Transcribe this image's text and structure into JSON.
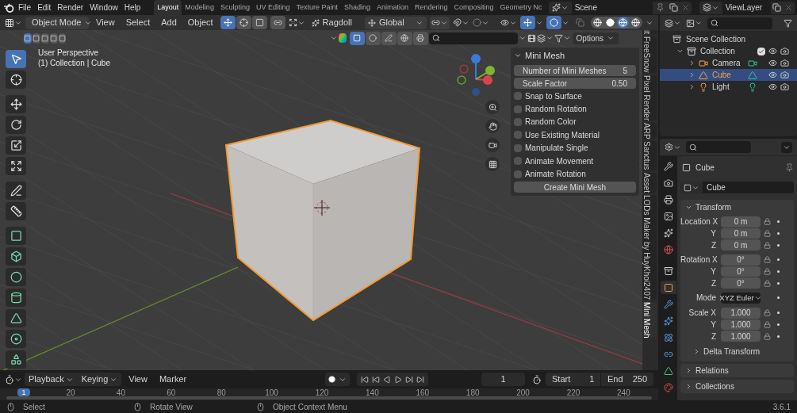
{
  "menu": [
    "File",
    "Edit",
    "Render",
    "Window",
    "Help"
  ],
  "workspaces": [
    {
      "label": "Layout",
      "selected": true
    },
    {
      "label": "Modeling",
      "selected": false
    },
    {
      "label": "Sculpting",
      "selected": false
    },
    {
      "label": "UV Editing",
      "selected": false
    },
    {
      "label": "Texture Paint",
      "selected": false
    },
    {
      "label": "Shading",
      "selected": false
    },
    {
      "label": "Animation",
      "selected": false
    },
    {
      "label": "Rendering",
      "selected": false
    },
    {
      "label": "Compositing",
      "selected": false
    },
    {
      "label": "Geometry Nc",
      "selected": false
    }
  ],
  "scene": "Scene",
  "view_layer": "ViewLayer",
  "viewport_header": {
    "mode": "Object Mode",
    "menus": [
      "View",
      "Select",
      "Add",
      "Object"
    ],
    "ragdoll": "Ragdoll",
    "orientation": "Global",
    "options": "Options"
  },
  "select_modes": [
    {
      "selected": true
    },
    {
      "selected": false
    },
    {
      "selected": false
    },
    {
      "selected": false
    },
    {
      "selected": false
    }
  ],
  "shading": [
    {
      "kind": "wireframe",
      "selected": false
    },
    {
      "kind": "solid",
      "selected": false
    },
    {
      "kind": "material",
      "selected": true
    },
    {
      "kind": "rendered",
      "selected": false
    }
  ],
  "viewport": {
    "perspective": "User Perspective",
    "context": "(1) Collection | Cube"
  },
  "tools": [
    {
      "kind": "select",
      "selected": true
    },
    {
      "kind": "cursor",
      "selected": false
    },
    {
      "kind": "move",
      "selected": false
    },
    {
      "kind": "rotate",
      "selected": false
    },
    {
      "kind": "scale",
      "selected": false
    },
    {
      "kind": "transform",
      "selected": false
    },
    {
      "kind": "annotate",
      "selected": false
    },
    {
      "kind": "measure",
      "selected": false
    },
    {
      "kind": "add-plane",
      "selected": false
    },
    {
      "kind": "add-cube",
      "selected": false
    },
    {
      "kind": "add-sphere",
      "selected": false
    },
    {
      "kind": "add-cylinder",
      "selected": false
    },
    {
      "kind": "add-cone",
      "selected": false
    },
    {
      "kind": "add-torus",
      "selected": false
    },
    {
      "kind": "add-wedge",
      "selected": false
    }
  ],
  "mini_mesh": {
    "title": "Mini Mesh",
    "fields": [
      {
        "label": "Number of Mini Meshes",
        "value": "5"
      },
      {
        "label": "Scale Factor",
        "value": "0.50"
      }
    ],
    "checkboxes": [
      {
        "label": "Snap to Surface",
        "checked": false
      },
      {
        "label": "Random Rotation",
        "checked": false
      },
      {
        "label": "Random Color",
        "checked": false
      },
      {
        "label": "Use Existing Material",
        "checked": false
      },
      {
        "label": "Manipulate Single",
        "checked": false
      },
      {
        "label": "Animate Movement",
        "checked": false
      },
      {
        "label": "Animate Rotation",
        "checked": false
      }
    ],
    "button": "Create Mini Mesh"
  },
  "side_tabs": [
    {
      "label": "it",
      "selected": false
    },
    {
      "label": "FreeSnow",
      "selected": false
    },
    {
      "label": "Pixel Render",
      "selected": false
    },
    {
      "label": "ARP",
      "selected": false
    },
    {
      "label": "Sanctus",
      "selected": false
    },
    {
      "label": "Asset",
      "selected": false
    },
    {
      "label": "LODs Maker by HuyKhoi2407",
      "selected": false
    },
    {
      "label": "Mini Mesh",
      "selected": true
    }
  ],
  "timeline": {
    "menus": [
      "Playback",
      "Keying",
      "View",
      "Marker"
    ],
    "current_frame": "1",
    "start_label": "Start",
    "start": "1",
    "end_label": "End",
    "end": "250",
    "playhead": "1",
    "ticks": [
      "20",
      "40",
      "60",
      "80",
      "100",
      "120",
      "140",
      "160",
      "180",
      "200",
      "220",
      "240"
    ]
  },
  "outliner": {
    "root": "Scene Collection",
    "items": [
      {
        "name": "Collection",
        "kind": "collection",
        "checked": true,
        "expanded": true,
        "selected": false,
        "children": [
          {
            "name": "Camera",
            "kind": "camera",
            "selected": false
          },
          {
            "name": "Cube",
            "kind": "mesh",
            "selected": true
          },
          {
            "name": "Light",
            "kind": "light",
            "selected": false
          }
        ]
      }
    ]
  },
  "property_tabs": [
    {
      "kind": "tool",
      "selected": false
    },
    {
      "kind": "render",
      "selected": false
    },
    {
      "kind": "output",
      "selected": false
    },
    {
      "kind": "view-layer",
      "selected": false
    },
    {
      "kind": "scene",
      "selected": false
    },
    {
      "kind": "world",
      "selected": false
    },
    {
      "kind": "collection",
      "selected": false
    },
    {
      "kind": "object",
      "selected": true
    },
    {
      "kind": "modifiers",
      "selected": false
    },
    {
      "kind": "particles",
      "selected": false
    },
    {
      "kind": "physics",
      "selected": false
    },
    {
      "kind": "constraints",
      "selected": false
    },
    {
      "kind": "data",
      "selected": false
    },
    {
      "kind": "material",
      "selected": false
    }
  ],
  "properties": {
    "object_name": "Cube",
    "data_name": "Cube",
    "transform": {
      "title": "Transform",
      "expanded": true,
      "groups": [
        {
          "kind": "fields",
          "rows": [
            {
              "label": "Location X",
              "value": "0 m"
            },
            {
              "label": "Y",
              "value": "0 m"
            },
            {
              "label": "Z",
              "value": "0 m"
            }
          ]
        },
        {
          "kind": "fields",
          "rows": [
            {
              "label": "Rotation X",
              "value": "0°"
            },
            {
              "label": "Y",
              "value": "0°"
            },
            {
              "label": "Z",
              "value": "0°"
            }
          ]
        },
        {
          "kind": "dropdown",
          "rows": [
            {
              "label": "Mode",
              "value": "XYZ Euler"
            }
          ]
        },
        {
          "kind": "fields",
          "rows": [
            {
              "label": "Scale X",
              "value": "1.000"
            },
            {
              "label": "Y",
              "value": "1.000"
            },
            {
              "label": "Z",
              "value": "1.000"
            }
          ]
        }
      ],
      "sub": {
        "title": "Delta Transform",
        "expanded": false
      }
    },
    "panels": [
      {
        "title": "Relations",
        "expanded": false
      },
      {
        "title": "Collections",
        "expanded": false
      }
    ]
  },
  "status_bar": {
    "hints": [
      "Select",
      "Rotate View",
      "Object Context Menu"
    ],
    "version": "3.6.1"
  }
}
